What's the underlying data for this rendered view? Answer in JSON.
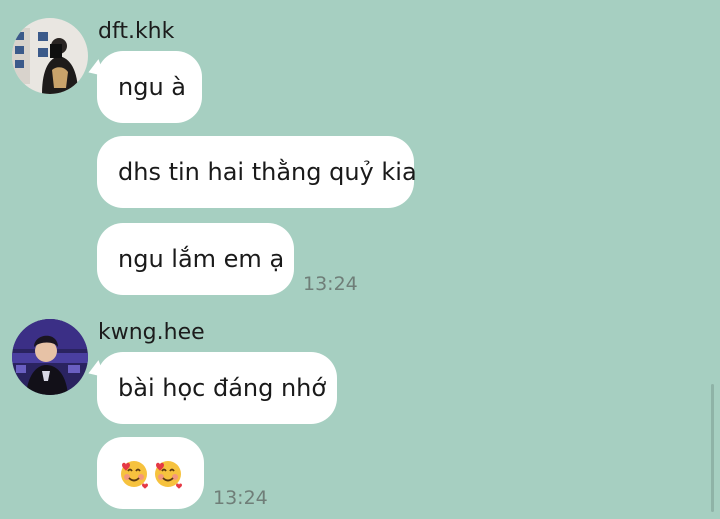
{
  "colors": {
    "chat_background": "#a6cfc1",
    "bubble": "#ffffff",
    "timestamp": "#6f7e78"
  },
  "messages": [
    {
      "sender": "dft.khk",
      "avatar_icon": "user-avatar-photo",
      "bubbles": [
        "ngu à",
        "dhs tin hai thằng quỷ kia",
        "ngu lắm em ạ"
      ],
      "time": "13:24"
    },
    {
      "sender": "kwng.hee",
      "avatar_icon": "user-avatar-photo",
      "bubbles": [
        "bài học đáng nhớ",
        "🥰🥰"
      ],
      "emoji_icons": [
        "smiling-face-with-hearts-icon",
        "smiling-face-with-hearts-icon"
      ],
      "time": "13:24"
    }
  ]
}
